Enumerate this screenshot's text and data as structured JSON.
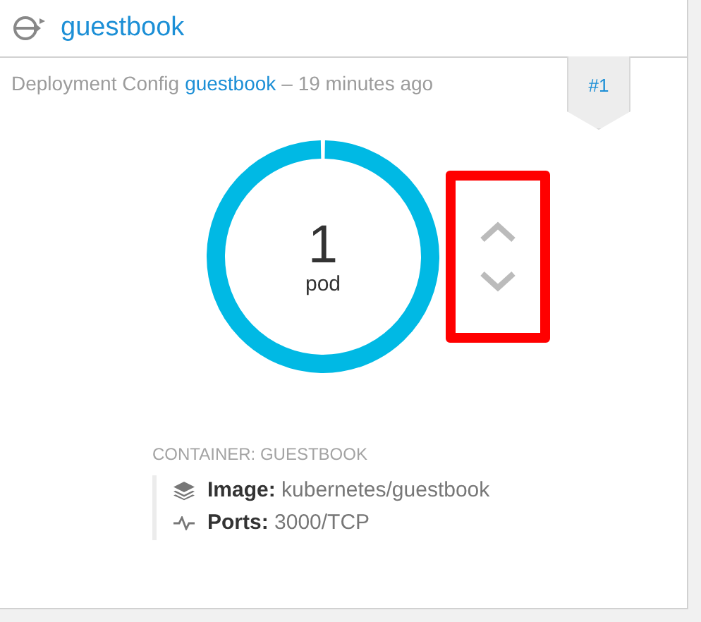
{
  "header": {
    "title": "guestbook"
  },
  "deployment": {
    "kind_label": "Deployment Config",
    "name": "guestbook",
    "age": "– 19 minutes ago",
    "badge": "#1"
  },
  "donut": {
    "count": "1",
    "unit": "pod",
    "level": 1
  },
  "scale_controls": {
    "highlighted": true
  },
  "container": {
    "heading": "CONTAINER: GUESTBOOK",
    "details": [
      {
        "kind": "image",
        "text": "**Image:** kubernetes/guestbook"
      },
      {
        "kind": "ports",
        "text": "**Ports:** 3000/TCP"
      }
    ]
  }
}
